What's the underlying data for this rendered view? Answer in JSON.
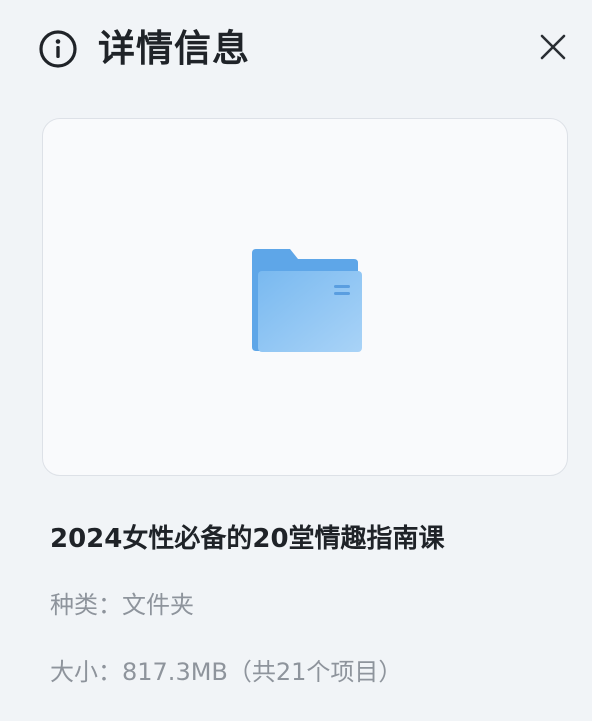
{
  "header": {
    "title": "详情信息",
    "info_icon": "info-circle-icon",
    "close_icon": "close-icon"
  },
  "preview": {
    "icon": "folder-icon",
    "folder_color": "#6db0ee"
  },
  "file": {
    "name": "2024女性必备的20堂情趣指南课",
    "type_label": "种类：",
    "type_value": "文件夹",
    "size_label": "大小：",
    "size_value": "817.3MB（共21个项目）"
  },
  "colors": {
    "background": "#f1f4f7",
    "card": "#f9fafc",
    "text_primary": "#1f2328",
    "text_secondary": "#8e949c"
  }
}
